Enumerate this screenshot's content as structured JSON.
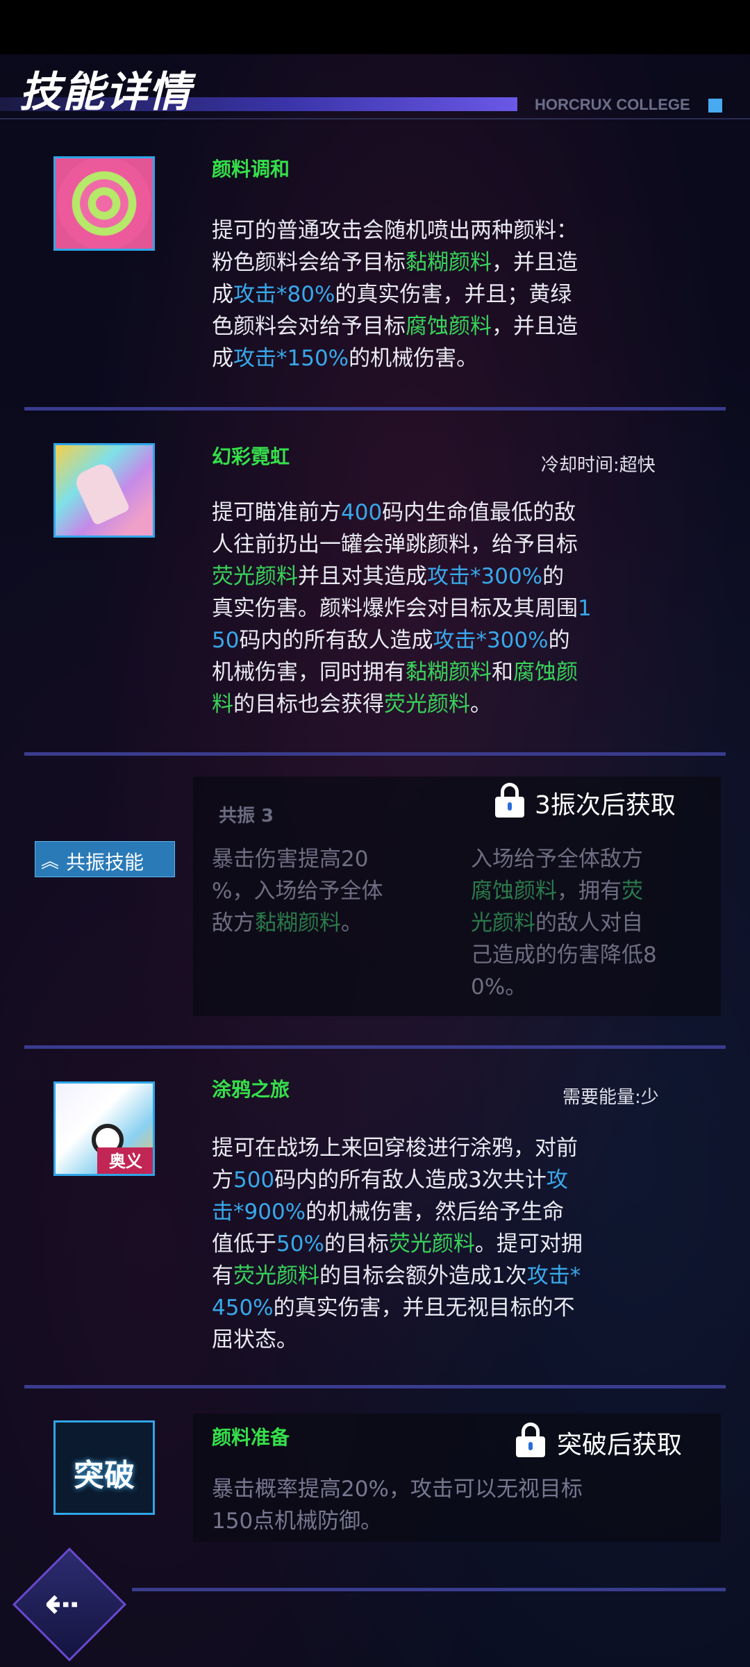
{
  "header": {
    "title": "技能详情",
    "college": "HORCRUX COLLEGE"
  },
  "skills": [
    {
      "name": "颜料调和",
      "meta": "",
      "desc_html": "提可的普通攻击会随机喷出两种颜料：<br>粉色颜料会给予目标<span class=\"g\">黏糊颜料</span>，并且造<br>成<span class=\"b\">攻击*80%</span>的真实伤害，并且；黄绿<br>色颜料会对给予目标<span class=\"g\">腐蚀颜料</span>，并且造<br>成<span class=\"b\">攻击*150%</span>的机械伤害。"
    },
    {
      "name": "幻彩霓虹",
      "meta": "冷却时间:超快",
      "desc_html": "提可瞄准前方<span class=\"b\">400</span>码内生命值最低的敌<br>人往前扔出一罐会弹跳颜料，给予目标<br><span class=\"g\">荧光颜料</span>并且对其造成<span class=\"b\">攻击*300%</span>的<br>真实伤害。颜料爆炸会对目标及其周围<span class=\"b\">1</span><br><span class=\"b\">50</span>码内的所有敌人造成<span class=\"b\">攻击*300%</span>的<br>机械伤害，同时拥有<span class=\"g\">黏糊颜料</span>和<span class=\"g\">腐蚀颜</span><br><span class=\"g\">料</span>的目标也会获得<span class=\"g\">荧光颜料</span>。"
    },
    {
      "name": "涂鸦之旅",
      "meta": "需要能量:少",
      "tag": "奥义",
      "desc_html": "提可在战场上来回穿梭进行涂鸦，对前<br>方<span class=\"b\">500</span>码内的所有敌人造成3次共计<span class=\"b\">攻</span><br><span class=\"b\">击*900%</span>的机械伤害，然后给予生命<br>值低于<span class=\"b\">50%</span>的目标<span class=\"g\">荧光颜料</span>。提可对拥<br>有<span class=\"g\">荧光颜料</span>的目标会额外造成1次<span class=\"b\">攻击*</span><br><span class=\"b\">450%</span>的真实伤害，并且无视目标的不<br>屈状态。"
    },
    {
      "name": "颜料准备",
      "icon_text": "突破",
      "lock_text": "突破后获取",
      "desc_html": "暴击概率提高<span class=\"b\">20%</span>，攻击可以无视目标<br><span class=\"b\">150</span>点机械防御。"
    }
  ],
  "resonance": {
    "badge": "共振技能",
    "lock_text": "3振次后获取",
    "card1_title": "共振 3",
    "card1_desc_html": "暴击伤害提高<span class=\"b\">20</span><br><span class=\"b\">%</span>，入场给予全体<br>敌方<span class=\"g\">黏糊颜料</span>。",
    "card2_desc_html": "入场给予全体敌方<br><span class=\"g\">腐蚀颜料</span>，拥有<span class=\"g\">荧</span><br><span class=\"g\">光颜料</span>的敌人对自<br>己造成的伤害降低<span class=\"b\">8</span><br><span class=\"b\">0%</span>。"
  },
  "icons": {
    "lock": "lock-icon",
    "back": "back-arrow-icon",
    "resonance": "double-chevron-up-icon"
  }
}
